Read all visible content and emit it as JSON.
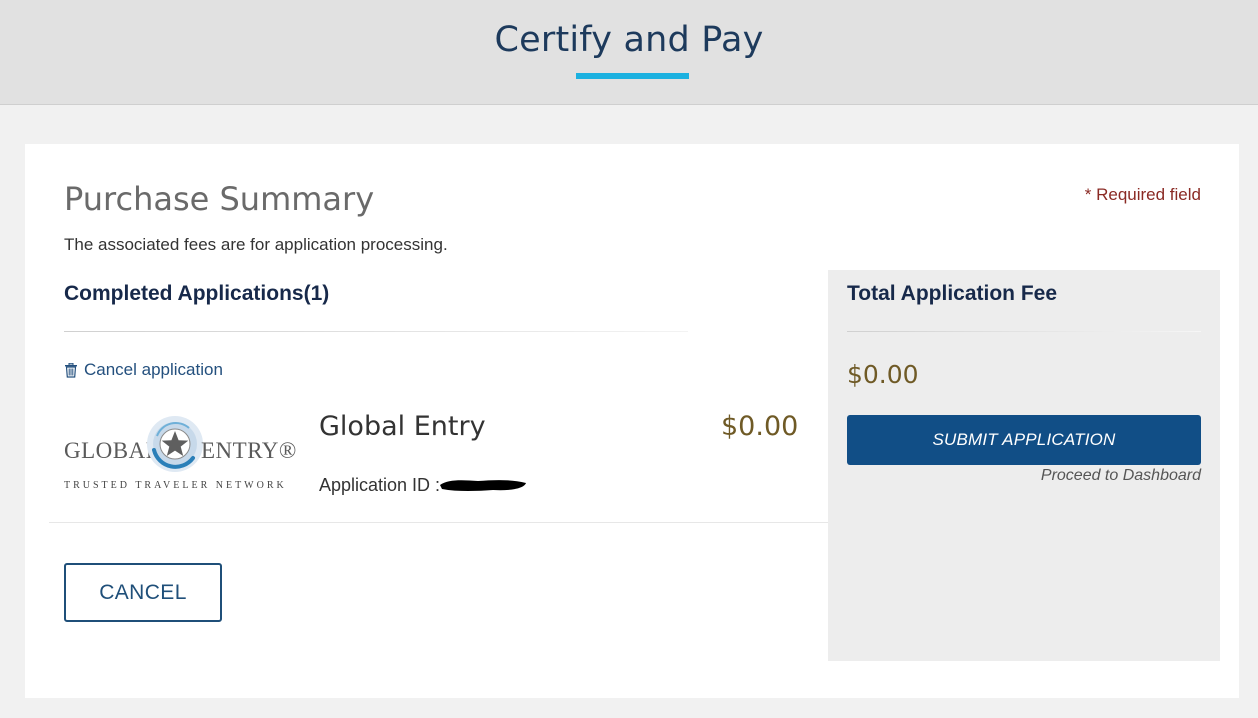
{
  "header": {
    "title": "Certify and Pay"
  },
  "summary": {
    "title": "Purchase Summary",
    "required_note": "* Required field",
    "description": "The associated fees are for application processing."
  },
  "applications": {
    "heading": "Completed Applications(1)",
    "cancel_link": "Cancel application",
    "items": [
      {
        "logo_text_global": "GLOBAL",
        "logo_text_entry": "ENTRY®",
        "logo_tagline": "TRUSTED TRAVELER NETWORK",
        "name": "Global Entry",
        "fee": "$0.00",
        "app_id_label": "Application ID :"
      }
    ]
  },
  "actions": {
    "cancel_label": "CANCEL"
  },
  "fee_panel": {
    "title": "Total Application Fee",
    "total": "$0.00",
    "submit_label": "SUBMIT APPLICATION",
    "proceed_text": "Proceed to Dashboard"
  },
  "colors": {
    "accent_underline": "#1bb1e0",
    "primary_button": "#114e86",
    "fee_text": "#6f5a26",
    "required_text": "#8a2a24"
  },
  "icons": {
    "cancel_application": "trash-icon",
    "logo_emblem": "star-emblem-icon",
    "redaction": "redaction-mark"
  }
}
